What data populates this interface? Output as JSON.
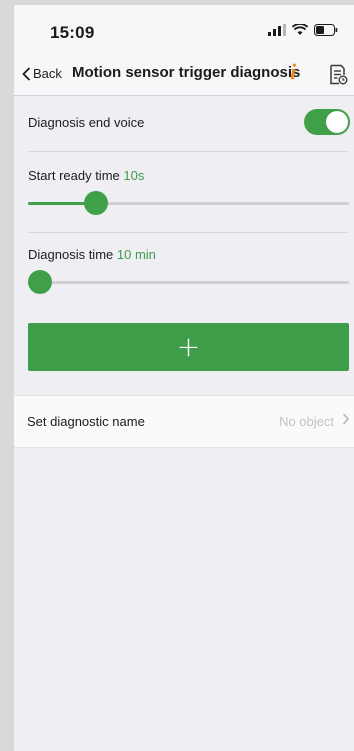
{
  "status": {
    "time": "15:09"
  },
  "nav": {
    "back_label": "Back",
    "title": "Motion sensor trigger diagnosis",
    "info_glyph": "i"
  },
  "settings": {
    "end_voice": {
      "label": "Diagnosis end voice",
      "enabled": true
    },
    "start_ready": {
      "label": "Start ready time",
      "value": "10s",
      "fraction": 0.19
    },
    "diag_time": {
      "label": "Diagnosis time",
      "value": "10 min",
      "fraction": 0.0
    }
  },
  "add_button": {
    "label": "+"
  },
  "name_row": {
    "label": "Set diagnostic name",
    "value": "No object"
  },
  "colors": {
    "accent": "#3fa049",
    "info": "#f08a1c"
  }
}
